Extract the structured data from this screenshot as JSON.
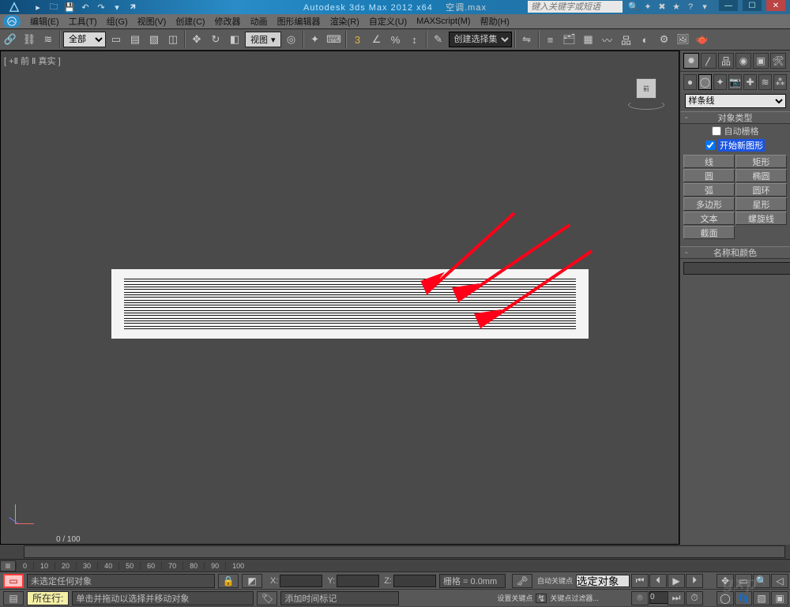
{
  "app": {
    "title_prefix": "Autodesk 3ds Max  2012  x64",
    "document": "空调.max",
    "search_placeholder": "键入关键字或短语"
  },
  "menus": [
    "编辑(E)",
    "工具(T)",
    "组(G)",
    "视图(V)",
    "创建(C)",
    "修改器",
    "动画",
    "图形编辑器",
    "渲染(R)",
    "自定义(U)",
    "MAXScript(M)",
    "帮助(H)"
  ],
  "toolbar": {
    "filter": "全部",
    "view_label": "视图",
    "create_sel_set_placeholder": "创建选择集"
  },
  "viewport": {
    "tag": "[ +Ⅱ 前 Ⅱ 真实 ]",
    "cube_face": "前"
  },
  "timeline": {
    "current": "0 / 100",
    "ticks": [
      0,
      10,
      20,
      30,
      40,
      50,
      60,
      70,
      80,
      90,
      100
    ]
  },
  "cmd": {
    "shape_type": "样条线",
    "rollout_type_header": "对象类型",
    "auto_grid": "自动栅格",
    "start_new": "开始新图形",
    "shape_buttons_left": [
      "线",
      "圆",
      "弧",
      "多边形",
      "文本",
      "截面"
    ],
    "shape_buttons_right": [
      "矩形",
      "椭圆",
      "圆环",
      "星形",
      "螺旋线",
      ""
    ],
    "rollout_namecolor_header": "名称和颜色"
  },
  "status": {
    "row_btn": "所在行:",
    "none_selected": "未选定任何对象",
    "prompt": "单击并拖动以选择并移动对象",
    "grid": "栅格 = 0.0mm",
    "add_time_tag": "添加时间标记",
    "auto_key": "自动关键点",
    "set_key": "设置关键点",
    "selected": "选定对象",
    "key_filters": "关键点过滤器..."
  },
  "watermark": "gxp"
}
